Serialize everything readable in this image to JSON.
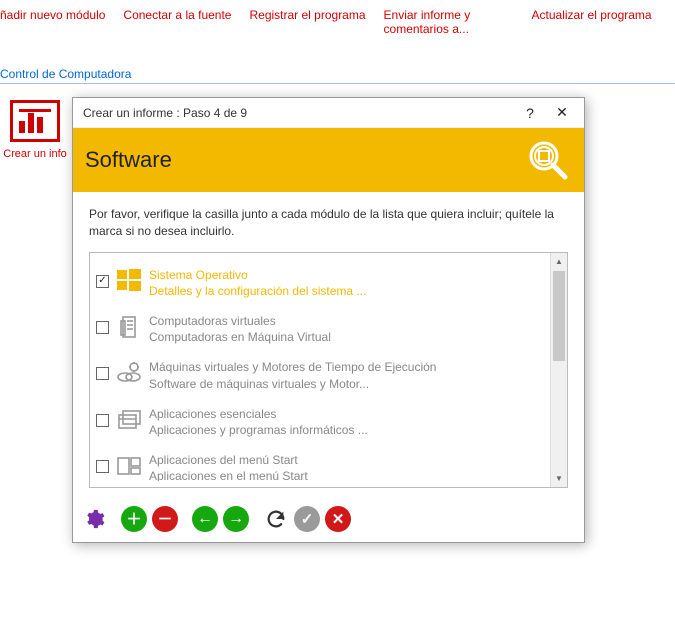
{
  "menu": {
    "items": [
      "ñadir nuevo módulo",
      "Conectar a la fuente",
      "Registrar el programa",
      "Enviar informe y comentarios a...",
      "Actualizar el programa"
    ]
  },
  "tab": {
    "label": "Control de Computadora"
  },
  "background": {
    "tileLabel": "Crear un info"
  },
  "dialog": {
    "title": "Crear un informe : Paso 4 de 9",
    "help": "?",
    "close": "✕",
    "header": "Software",
    "instruction": "Por favor, verifique la casilla junto a cada módulo de la lista que quiera incluir; quítele la marca si no desea incluirlo.",
    "modules": [
      {
        "title": "Sistema Operativo",
        "sub": "Detalles y la configuración del sistema ...",
        "checked": true,
        "active": true
      },
      {
        "title": "Computadoras virtuales",
        "sub": "Computadoras en Máquina Virtual",
        "checked": false,
        "active": false
      },
      {
        "title": "Máquinas virtuales y Motores de Tiempo de Ejecución",
        "sub": "Software de máquinas virtuales y Motor...",
        "checked": false,
        "active": false
      },
      {
        "title": "Aplicaciones esenciales",
        "sub": "Aplicaciones y programas informáticos ...",
        "checked": false,
        "active": false
      },
      {
        "title": "Aplicaciones del menú Start",
        "sub": "Aplicaciones en el menú Start",
        "checked": false,
        "active": false
      }
    ],
    "checkmark": "✓"
  }
}
